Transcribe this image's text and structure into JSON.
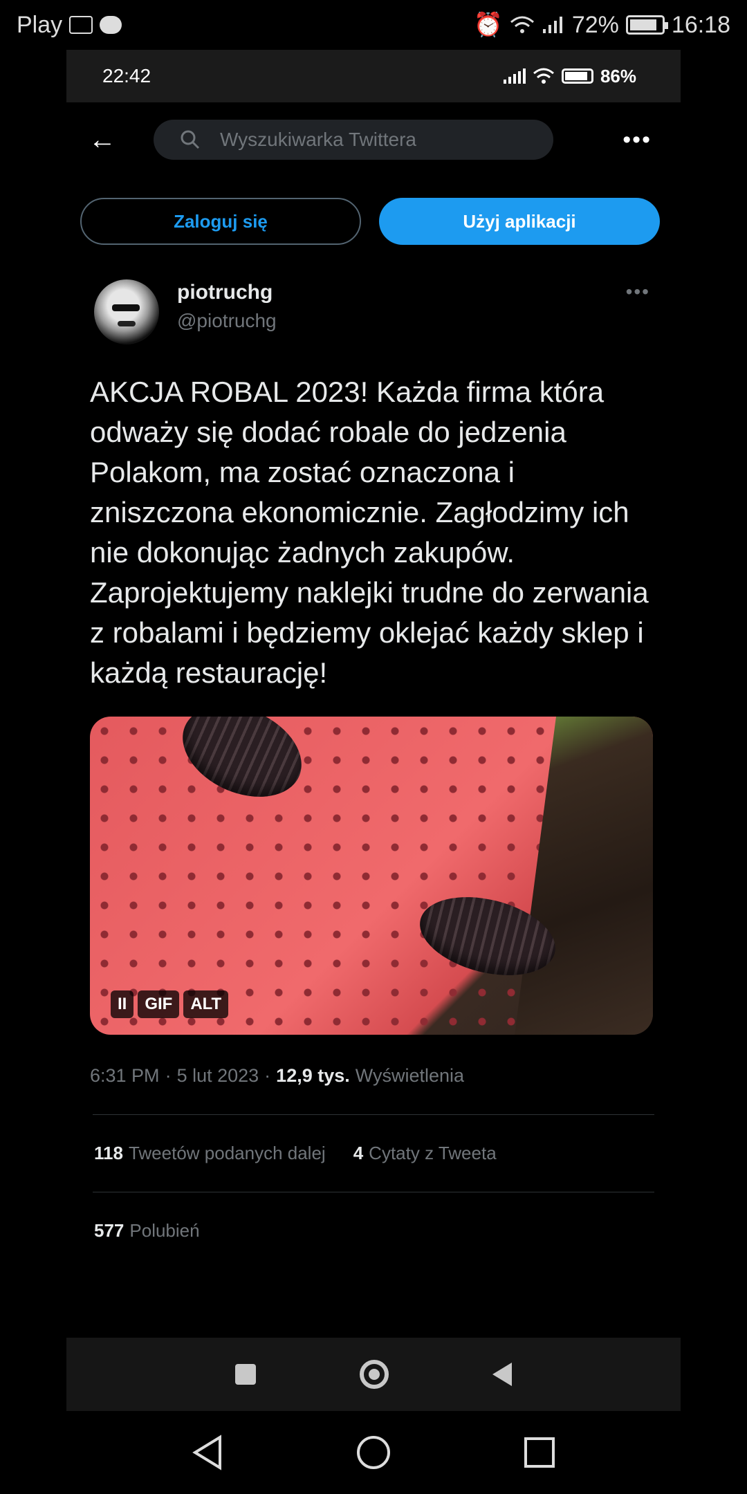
{
  "outer_status": {
    "carrier": "Play",
    "battery": "72%",
    "time": "16:18"
  },
  "inner_status": {
    "time": "22:42",
    "battery": "86%"
  },
  "topbar": {
    "search_placeholder": "Wyszukiwarka Twittera"
  },
  "auth": {
    "login_label": "Zaloguj się",
    "app_label": "Użyj aplikacji"
  },
  "tweet": {
    "display_name": "piotruchg",
    "handle": "@piotruchg",
    "text": "AKCJA ROBAL 2023! Każda firma która odważy się dodać robale do jedzenia Polakom, ma zostać oznaczona i zniszczona ekonomicznie. Zagłodzimy ich nie dokonując żadnych zakupów. Zaprojektujemy naklejki trudne do zerwania z robalami i będziemy oklejać każdy sklep i każdą restaurację!",
    "media_controls": {
      "pause": "II",
      "gif": "GIF",
      "alt": "ALT"
    },
    "time": "6:31 PM",
    "date": "5 lut 2023",
    "views_count": "12,9 tys.",
    "views_label": "Wyświetlenia",
    "retweets_count": "118",
    "retweets_label": "Tweetów podanych dalej",
    "quotes_count": "4",
    "quotes_label": "Cytaty z Tweeta",
    "likes_count": "577",
    "likes_label": "Polubień"
  }
}
